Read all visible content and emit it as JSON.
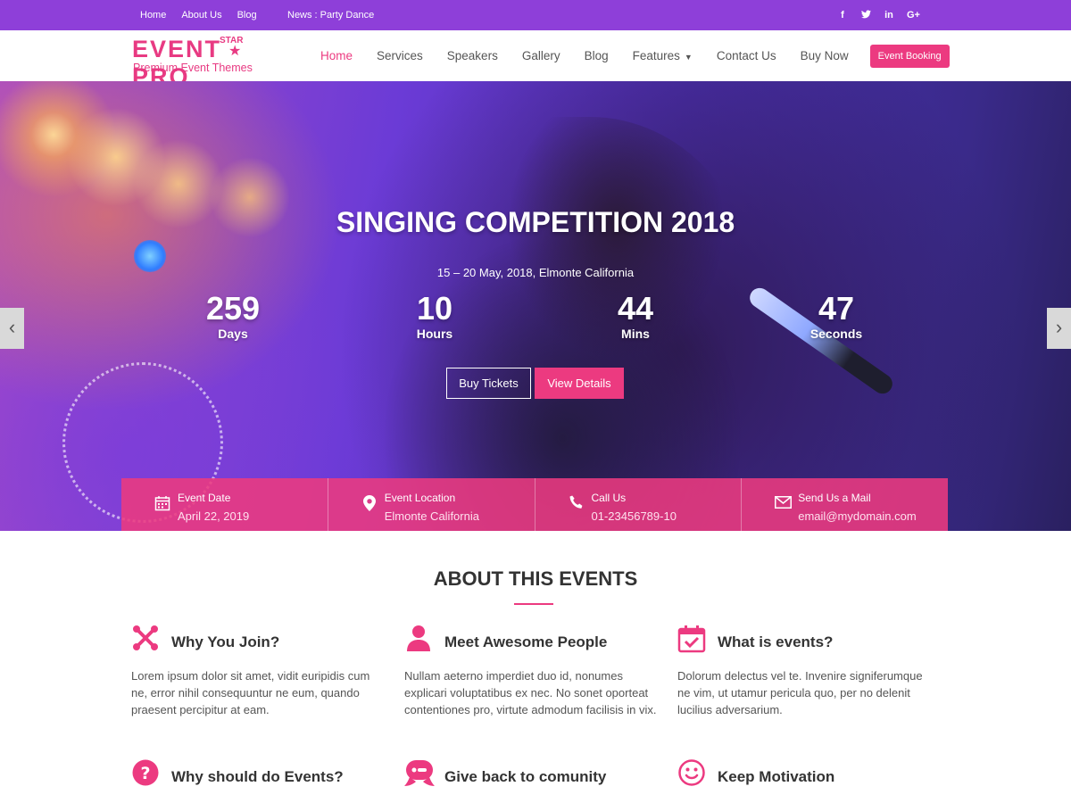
{
  "topbar": {
    "links": [
      "Home",
      "About Us",
      "Blog"
    ],
    "news": "News : Party Dance",
    "social": [
      "f",
      "t",
      "in",
      "G+"
    ]
  },
  "logo": {
    "word": "EVENT  PRO",
    "star_text": "STAR",
    "tagline": "Premium Event Themes"
  },
  "nav": {
    "items": [
      "Home",
      "Services",
      "Speakers",
      "Gallery",
      "Blog",
      "Features",
      "Contact Us",
      "Buy Now"
    ],
    "active": "Home",
    "booking": "Event Booking"
  },
  "hero": {
    "title": "SINGING COMPETITION 2018",
    "subtitle": "15 – 20 May, 2018, Elmonte California",
    "countdown": [
      {
        "value": "259",
        "label": "Days"
      },
      {
        "value": "10",
        "label": "Hours"
      },
      {
        "value": "44",
        "label": "Mins"
      },
      {
        "value": "47",
        "label": "Seconds"
      }
    ],
    "buy_label": "Buy Tickets",
    "details_label": "View Details",
    "prev_arrow": "‹",
    "next_arrow": "›"
  },
  "info": [
    {
      "icon": "calendar-icon",
      "title": "Event Date",
      "value": "April 22, 2019"
    },
    {
      "icon": "location-pin-icon",
      "title": "Event Location",
      "value": "Elmonte California"
    },
    {
      "icon": "phone-icon",
      "title": "Call Us",
      "value": "01-23456789-10"
    },
    {
      "icon": "mail-icon",
      "title": "Send Us a Mail",
      "value": "email@mydomain.com"
    }
  ],
  "about": {
    "title": "ABOUT THIS EVENTS",
    "features": [
      {
        "icon": "joomla-icon",
        "title": "Why You Join?",
        "text": "Lorem ipsum dolor sit amet, vidit euripidis cum ne, error nihil consequuntur ne eum, quando praesent percipitur at eam."
      },
      {
        "icon": "user-icon",
        "title": "Meet Awesome People",
        "text": "Nullam aeterno imperdiet duo id, nonumes explicari voluptatibus ex nec. No sonet oporteat contentiones pro, virtute admodum facilisis in vix."
      },
      {
        "icon": "calendar-check-icon",
        "title": "What is events?",
        "text": "Dolorum delectus vel te. Invenire signiferumque ne vim, ut utamur pericula quo, per no delenit lucilius adversarium."
      },
      {
        "icon": "question-icon",
        "title": "Why should do Events?",
        "text": ""
      },
      {
        "icon": "community-icon",
        "title": "Give back to comunity",
        "text": ""
      },
      {
        "icon": "smile-icon",
        "title": "Keep Motivation",
        "text": ""
      }
    ]
  },
  "colors": {
    "topbar": "#8e3fd9",
    "accent": "#ec3a80"
  }
}
